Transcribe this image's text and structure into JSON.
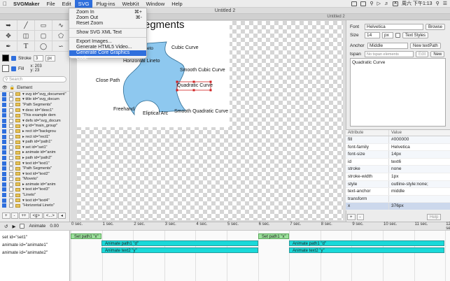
{
  "menubar": {
    "app": "SVGMaker",
    "items": [
      "File",
      "Edit",
      "SVG",
      "Plug-ins",
      "WebKit",
      "Window",
      "Help"
    ],
    "active": "SVG",
    "ime": "A",
    "clock": "周六 下午1:13"
  },
  "window": {
    "title": "Untitled 2",
    "tab": "Untitled 2"
  },
  "svg_menu": {
    "items": [
      {
        "label": "Zoom In",
        "shortcut": "⌘+"
      },
      {
        "label": "Zoom Out",
        "shortcut": "⌘-"
      },
      {
        "label": "Reset Zoom",
        "shortcut": ""
      },
      {
        "label": "Show SVG XML Text",
        "shortcut": ""
      },
      {
        "label": "Export Images...",
        "shortcut": ""
      },
      {
        "label": "Generate HTML5 Video...",
        "shortcut": ""
      },
      {
        "label": "Generate Core Graphics Code",
        "shortcut": ""
      }
    ]
  },
  "tools": {
    "stroke_label": "Stroke",
    "stroke_width": "3",
    "stroke_unit": "px",
    "fill_label": "Fill",
    "coord_x": "x: 203",
    "coord_y": "y: 23",
    "search_placeholder": "Search",
    "tree_header": "Element"
  },
  "tree": [
    "▾ svg id=\"svg_document\"",
    "  ▾ title id=\"svg_docum",
    "      \"Path Segments\"",
    "  ▾ desc id=\"desc1\"",
    "      \"This example dem",
    "  ▾ defs id=\"svg_docum",
    "  ▾ g id=\"main_group\"",
    "    ▸ rect id=\"backgrou",
    "    ▸ rect id=\"rect1\"",
    "    ▾ path id=\"path1\"",
    "      ▾ set id=\"set1\"",
    "      ▸ animate id=\"anim",
    "    ▸ path id=\"path2\"",
    "    ▾ text id=\"text1\"",
    "        \"Path Segments\"",
    "    ▾ text id=\"text2\"",
    "        \"Moveto\"",
    "      ▸ animate id=\"anim",
    "    ▾ text id=\"text3\"",
    "        \"Lineto\"",
    "    ▾ text id=\"text4\"",
    "        \"Horizontal Lineto\""
  ],
  "tree_buttons": [
    "+",
    "-",
    "++",
    "<g>",
    "<...>",
    "◂"
  ],
  "canvas": {
    "title": "egments",
    "labels": [
      "Cubic Curve",
      "Horizontal Lineto",
      "Smooth Cubic Curve",
      "Close Path",
      "Quadratic Curve",
      "Freehand",
      "Eliptical Arc",
      "Smooth Quadratic Curve",
      "eto"
    ],
    "shape_color": "#8ec8ef"
  },
  "inspector": {
    "font_label": "Font",
    "font_value": "Helvetica",
    "browse": "Browse",
    "size_label": "Size",
    "size_value": "14",
    "size_unit": "px",
    "text_styles": "Text Styles",
    "anchor_label": "Anchor",
    "anchor_value": "Middle",
    "new_textpath": "New textPath",
    "tspan_label": "tspan",
    "tspan_value": "No tspan elements defined",
    "edit": "Edit",
    "new": "New",
    "text_content": "Quadratic Curve",
    "attr_header": "Attribute",
    "value_header": "Value"
  },
  "attributes": [
    {
      "name": "fill",
      "value": "#000000"
    },
    {
      "name": "font-family",
      "value": "Helvetica"
    },
    {
      "name": "font-size",
      "value": "14px"
    },
    {
      "name": "id",
      "value": "text6"
    },
    {
      "name": "stroke",
      "value": "none"
    },
    {
      "name": "stroke-width",
      "value": "1px"
    },
    {
      "name": "style",
      "value": "outline-style:none;"
    },
    {
      "name": "text-anchor",
      "value": "middle"
    },
    {
      "name": "transform",
      "value": ""
    },
    {
      "name": "x",
      "value": "376px"
    }
  ],
  "attr_buttons": [
    "+",
    "-"
  ],
  "help": "Help",
  "timeline": {
    "animate_label": "Animate",
    "time": "0.00",
    "ticks": [
      "0 sec.",
      "1 sec.",
      "2 sec.",
      "3 sec.",
      "4 sec.",
      "5 sec.",
      "6 sec.",
      "7 sec.",
      "8 sec.",
      "9 sec.",
      "10 sec.",
      "11 sec.",
      "12 se"
    ],
    "tracks": [
      "set id=\"set1\"",
      "animate id=\"animate1\"",
      "animate id=\"animate2\""
    ],
    "bars": {
      "set_a": "Set path1 \"x\"",
      "anim_a1": "Animate path1 \"d\"",
      "anim_a2": "Animate text2 \"y\"",
      "set_b": "Set path1 \"x\"",
      "anim_b1": "Animate path1 \"d\"",
      "anim_b2": "Animate text2 \"y\""
    }
  }
}
